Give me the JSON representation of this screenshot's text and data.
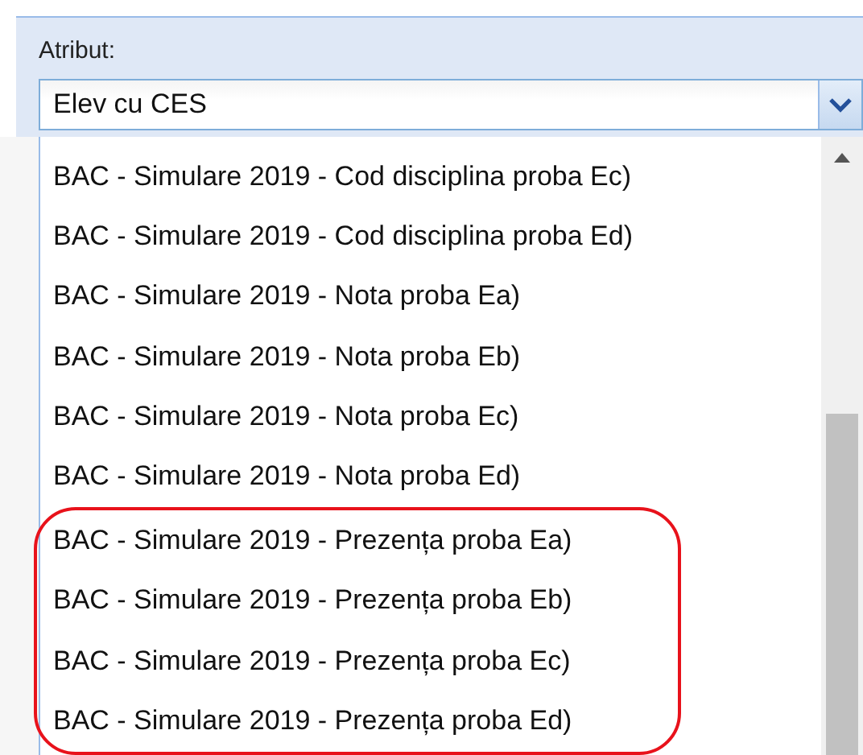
{
  "field": {
    "label": "Atribut:",
    "value": "Elev cu CES"
  },
  "options": [
    {
      "label": "BAC - Simulare 2019 - Cod disciplina proba Ec)",
      "circled": false
    },
    {
      "label": "BAC - Simulare 2019 - Cod disciplina proba Ed)",
      "circled": false
    },
    {
      "label": "BAC - Simulare 2019 - Nota proba Ea)",
      "circled": false
    },
    {
      "label": "BAC - Simulare 2019 - Nota proba Eb)",
      "circled": false
    },
    {
      "label": "BAC - Simulare 2019 - Nota proba Ec)",
      "circled": false
    },
    {
      "label": "BAC - Simulare 2019 - Nota proba Ed)",
      "circled": false
    },
    {
      "label": "BAC - Simulare 2019 - Prezența proba Ea)",
      "circled": true
    },
    {
      "label": "BAC - Simulare 2019 - Prezența proba Eb)",
      "circled": true
    },
    {
      "label": "BAC - Simulare 2019 - Prezența proba Ec)",
      "circled": true
    },
    {
      "label": "BAC - Simulare 2019 - Prezența proba Ed)",
      "circled": true
    }
  ]
}
